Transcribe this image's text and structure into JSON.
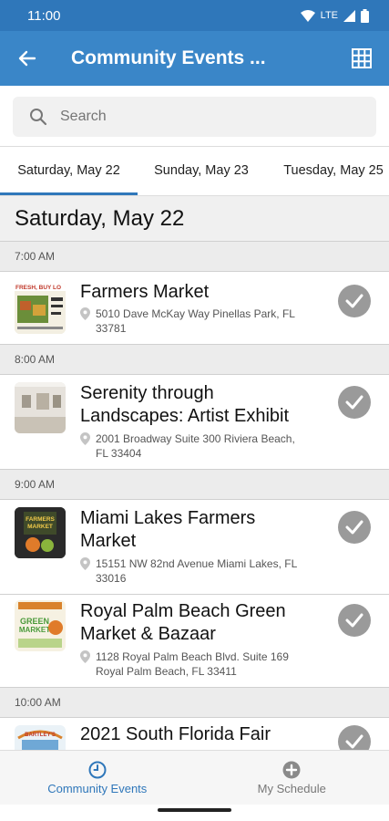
{
  "status_bar": {
    "time": "11:00",
    "network": "LTE"
  },
  "app_bar": {
    "title": "Community Events ..."
  },
  "search": {
    "placeholder": "Search"
  },
  "tabs": [
    {
      "label": "Saturday, May 22",
      "active": true
    },
    {
      "label": "Sunday, May 23",
      "active": false
    },
    {
      "label": "Tuesday, May 25",
      "active": false
    }
  ],
  "date_heading": "Saturday, May 22",
  "time_slots": [
    "7:00 AM",
    "8:00 AM",
    "9:00 AM",
    "10:00 AM"
  ],
  "events": [
    {
      "title": "Farmers Market",
      "address_line1": "5010 Dave McKay Way Pinellas Park, FL",
      "address_line2": "33781",
      "thumb_text": "FRESH, BUY LO"
    },
    {
      "title_line1": "Serenity through",
      "title_line2": "Landscapes: Artist Exhibit",
      "address_line1": "2001 Broadway Suite 300 Riviera Beach,",
      "address_line2": "FL 33404"
    },
    {
      "title_line1": "Miami Lakes Farmers",
      "title_line2": "Market",
      "address_line1": "15151 NW 82nd Avenue  Miami Lakes, FL",
      "address_line2": "33016",
      "thumb_text_1": "FARMERS",
      "thumb_text_2": "MARKET"
    },
    {
      "title_line1": "Royal Palm Beach Green",
      "title_line2": "Market & Bazaar",
      "address_line1": "1128 Royal Palm Beach Blvd. Suite 169",
      "address_line2": "Royal Palm Beach, FL 33411",
      "thumb_text_1": "GREEN",
      "thumb_text_2": "MARKET"
    },
    {
      "title": "2021 South Florida Fair",
      "thumb_text": "BARTLEY'S"
    }
  ],
  "bottom_nav": [
    {
      "label": "Community Events",
      "active": true
    },
    {
      "label": "My Schedule",
      "active": false
    }
  ],
  "colors": {
    "primary": "#3a86c8",
    "status_bar": "#2f77ba",
    "check_gray": "#9a9a9a"
  }
}
